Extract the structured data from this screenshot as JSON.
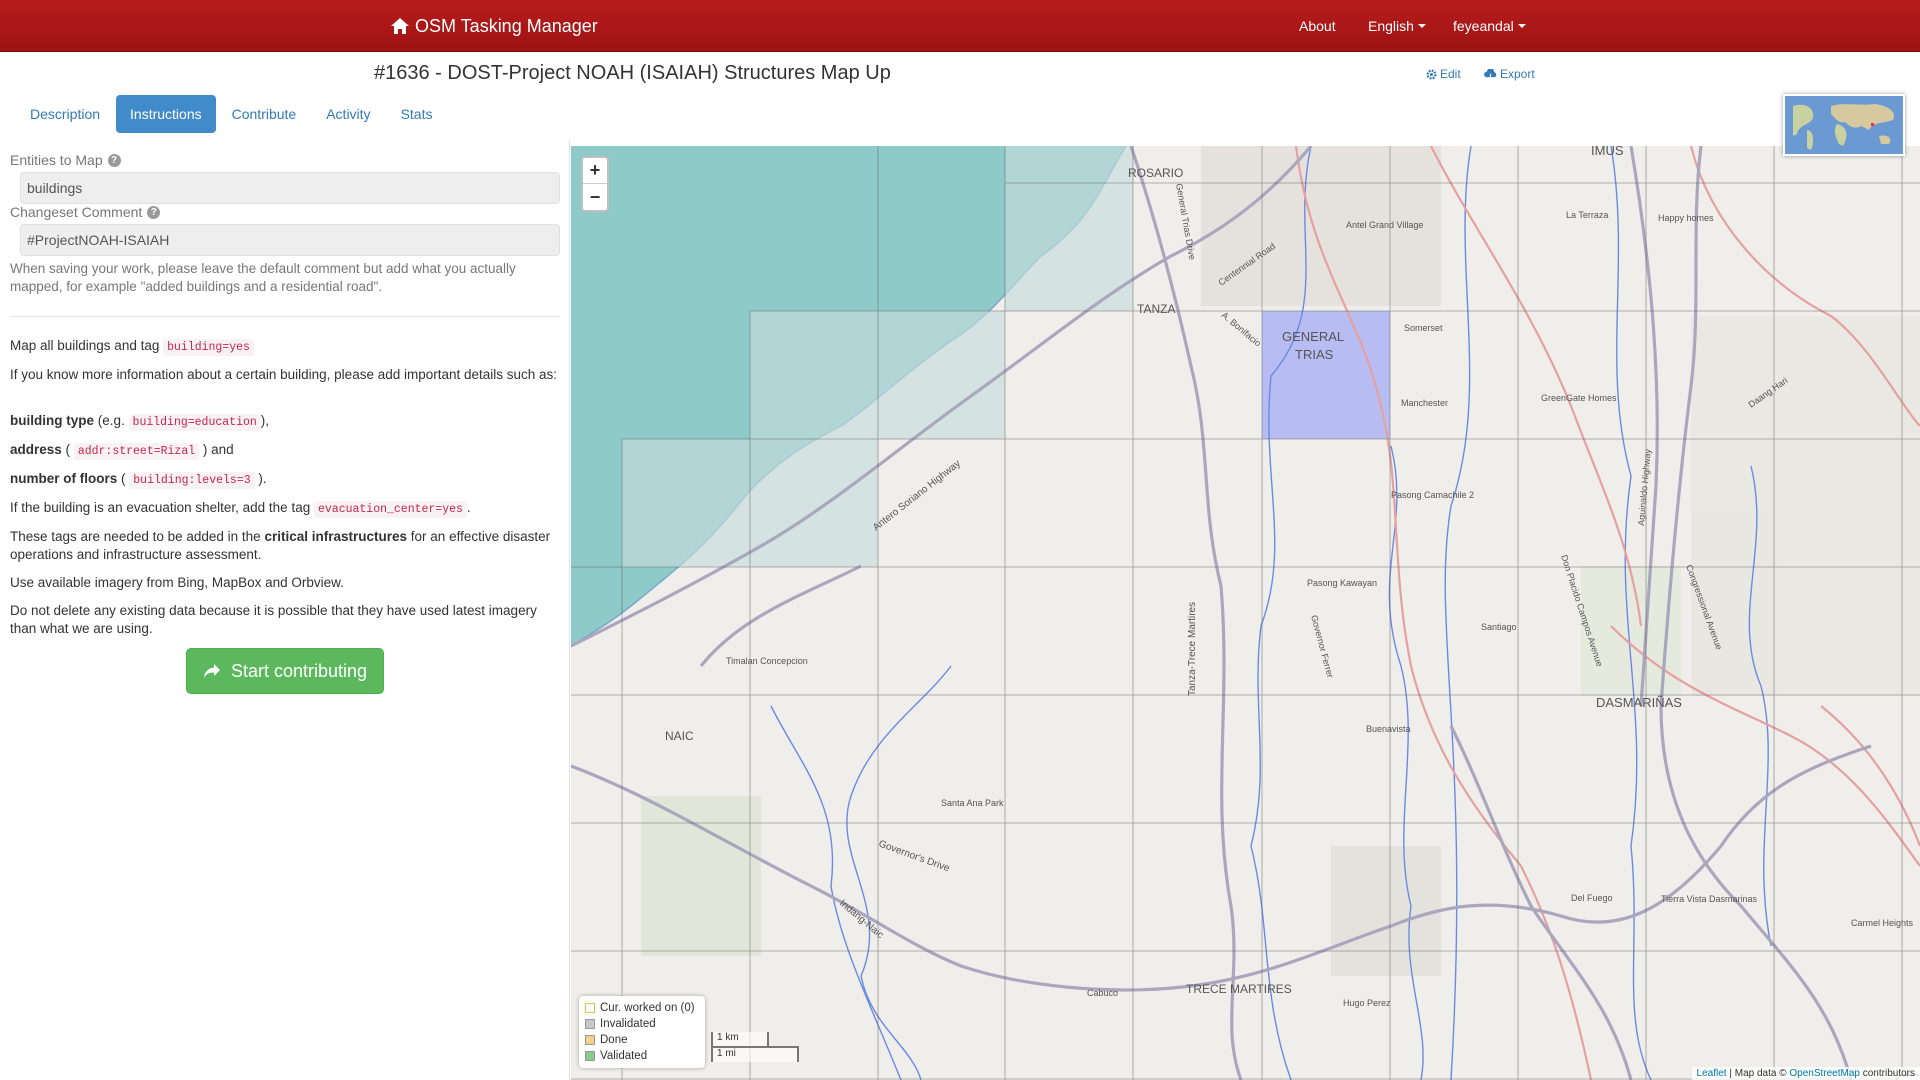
{
  "navbar": {
    "brand": "OSM Tasking Manager",
    "about": "About",
    "language": "English",
    "user": "feyeandal"
  },
  "project": {
    "title": "#1636 - DOST-Project NOAH (ISAIAH) Structures Map Up",
    "edit_label": "Edit",
    "export_label": "Export"
  },
  "tabs": [
    {
      "label": "Description"
    },
    {
      "label": "Instructions"
    },
    {
      "label": "Contribute"
    },
    {
      "label": "Activity"
    },
    {
      "label": "Stats"
    }
  ],
  "instructions": {
    "entities_label": "Entities to Map",
    "entities_value": "buildings",
    "comment_label": "Changeset Comment",
    "comment_value": "#ProjectNOAH-ISAIAH",
    "comment_help": "When saving your work, please leave the default comment but add what you actually mapped, for example \"added buildings and a residential road\".",
    "p1_text": "Map all buildings and tag",
    "p1_code": "building=yes",
    "p2": "If you know more information about a certain building, please add important details such as:",
    "p3_bold": "building type",
    "p3_eg": "(e.g.",
    "p3_code": "building=education",
    "p3_end": "),",
    "p4_bold": "address",
    "p4_open": "(",
    "p4_code": "addr:street=Rizal",
    "p4_end": ") and",
    "p5_bold": "number of floors",
    "p5_open": "(",
    "p5_code": "building:levels=3",
    "p5_end": ").",
    "p6_text": "If the building is an evacuation shelter, add the tag",
    "p6_code": "evacuation_center=yes",
    "p6_end": ".",
    "p7_start": "These tags are needed to be added in the",
    "p7_bold": "critical infrastructures",
    "p7_end": "for an effective disaster operations and infrastructure assessment.",
    "p8": "Use available imagery from Bing, MapBox and Orbview.",
    "p9": "Do not delete any existing data because it is possible that they have used latest imagery than what we are using.",
    "start_button": "Start contributing"
  },
  "map": {
    "zoom_in": "+",
    "zoom_out": "−",
    "places": {
      "imus": "IMUS",
      "rosario": "ROSARIO",
      "tanza": "TANZA",
      "general": "GENERAL",
      "trias": "TRIAS",
      "dasmarinas": "DASMARIÑAS",
      "naic": "NAIC",
      "trece": "TRECE MARTIRES",
      "antero": "Antero Soriano Highway",
      "governors": "Governor's Drive",
      "indang": "Indang-Naic",
      "tanza_trece": "Tanza-Trece Martires",
      "centennial": "Centennial Road",
      "bonifacio": "A. Bonifacio",
      "general_trias_drive": "General Trias Drive",
      "congressional": "Congressional Avenue",
      "daang_hari": "Daang Hari",
      "governor_ferrer": "Governor Ferrer",
      "don_placido": "Don Placido Campos Avenue",
      "aguinaldo": "Aguinaldo Highway",
      "santa_ana": "Santa Ana Park",
      "timalan": "Timalan Concepcion",
      "santiago": "Santiago",
      "pasong_kawayan": "Pasong Kawayan",
      "manchester": "Manchester",
      "buenavista": "Buenavista",
      "hugo_perez": "Hugo Perez",
      "cabuco": "Cabuco",
      "tierra_vista": "Tierra Vista Dasmarinas",
      "del_fuego": "Del Fuego",
      "la_terraza": "La Terraza",
      "happy_homes": "Happy homes",
      "greengate": "GreenGate Homes",
      "pasong_camachile": "Pasong Camachile 2",
      "antel": "Antel Grand Village",
      "somerset": "Somerset",
      "carmel": "Carmel Heights"
    },
    "legend": {
      "worked_on": "Cur. worked on (0)",
      "invalidated": "Invalidated",
      "done": "Done",
      "validated": "Validated"
    },
    "scale_km": "1 km",
    "scale_mi": "1 mi",
    "attribution_leaflet": "Leaflet",
    "attribution_text": "| Map data ©",
    "attribution_osm": "OpenStreetMap",
    "attribution_end": "contributors",
    "colors": {
      "sea": "#8ecbc8",
      "land": "#efeeea",
      "grid": "#555555",
      "selected": "#a4acf5",
      "road_major": "#a9a6be",
      "road_secondary": "#e59a9a",
      "river": "#6a8be3"
    }
  }
}
